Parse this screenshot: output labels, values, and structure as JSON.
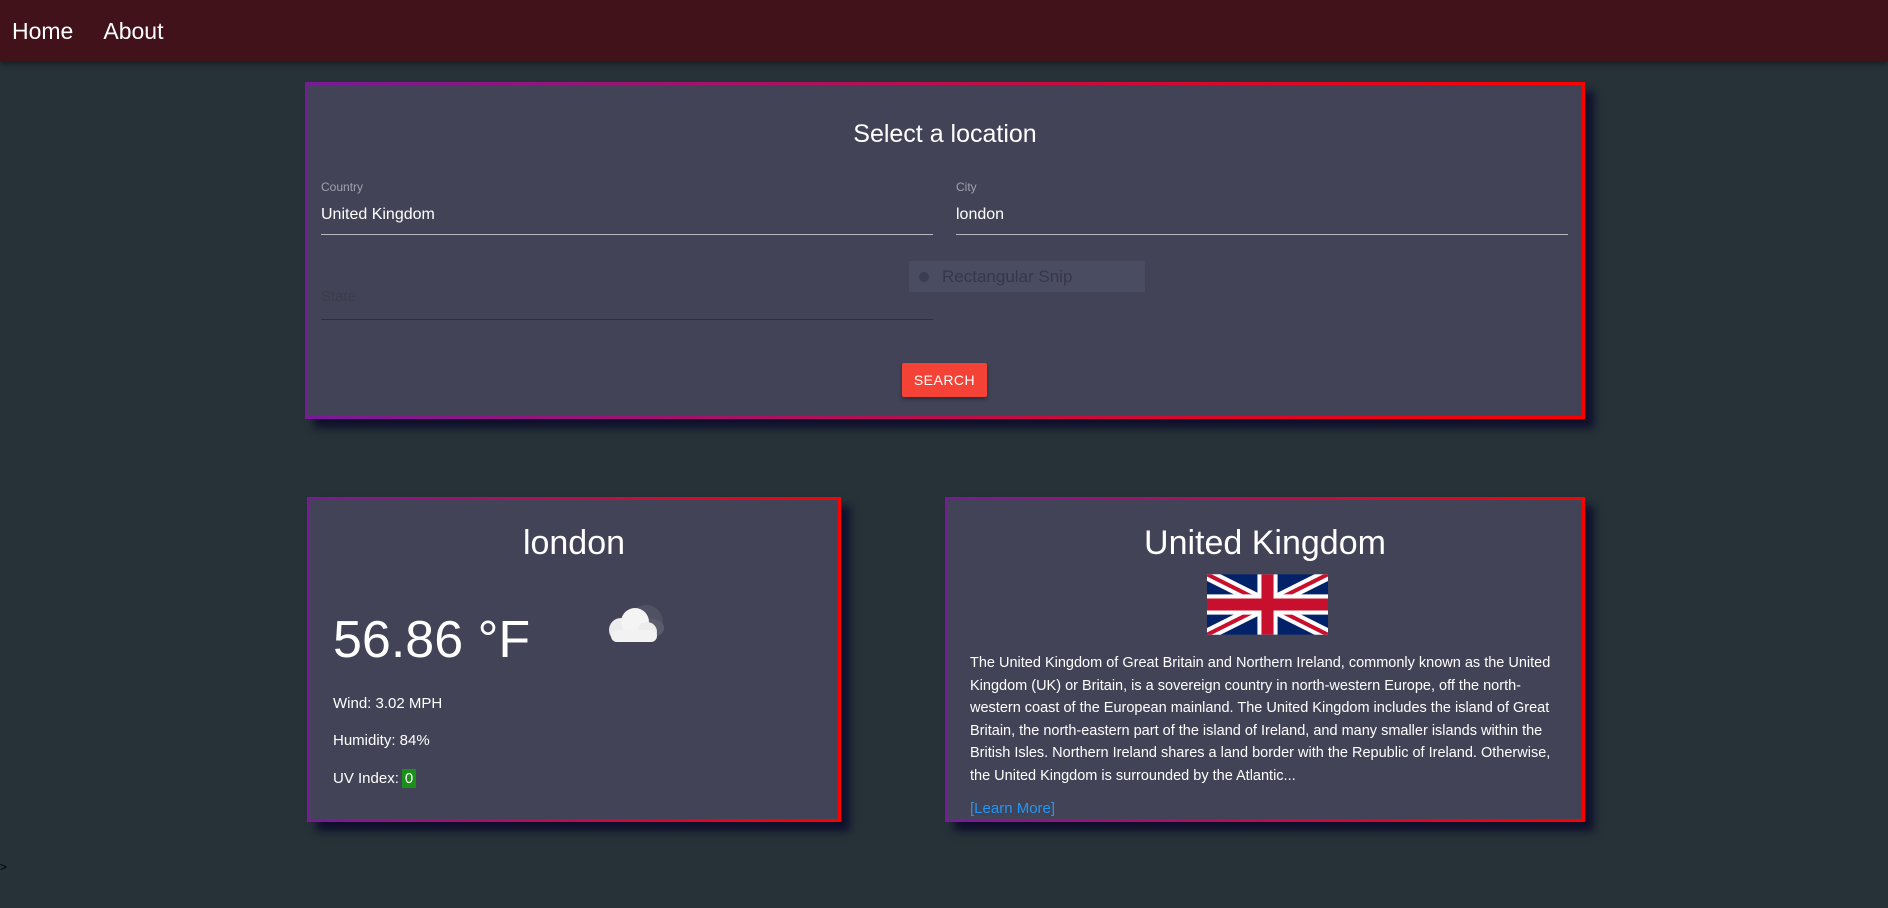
{
  "nav": {
    "home": "Home",
    "about": "About"
  },
  "search": {
    "title": "Select a location",
    "country_label": "Country",
    "country_value": "United Kingdom",
    "city_label": "City",
    "city_value": "london",
    "state_label": "State",
    "button_label": "SEARCH"
  },
  "snip_overlay": {
    "label": "Rectangular Snip"
  },
  "weather": {
    "city": "london",
    "temperature": "56.86 °F",
    "condition_icon": "cloud-icon",
    "wind": "Wind: 3.02 MPH",
    "humidity": "Humidity: 84%",
    "uv_label": "UV Index:",
    "uv_value": "0"
  },
  "country": {
    "name": "United Kingdom",
    "flag_icon": "uk-flag",
    "description": "The United Kingdom of Great Britain and Northern Ireland, commonly known as the United Kingdom (UK) or Britain, is a sovereign country in north-western Europe, off the north-western coast of the European mainland. The United Kingdom includes the island of Great Britain, the north-eastern part of the island of Ireland, and many smaller islands within the British Isles. Northern Ireland shares a land border with the Republic of Ireland. Otherwise, the United Kingdom is surrounded by the Atlantic...",
    "learn_more": "[Learn More]"
  },
  "colors": {
    "page_background": "#263238",
    "navbar": "#42121b",
    "card_background": "#424357",
    "border_gradient_start": "#7a1a9a",
    "border_gradient_end": "#ff0000",
    "button": "#f44336",
    "uv_badge": "#1a8f1a",
    "link": "#2196f3"
  },
  "cursor": ">"
}
